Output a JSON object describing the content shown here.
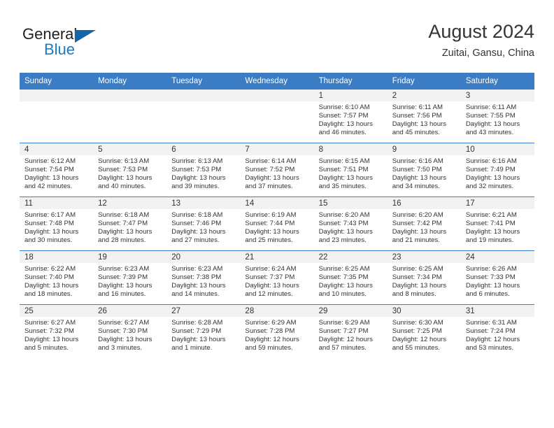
{
  "brand": {
    "name_top": "General",
    "name_bottom": "Blue",
    "accent_color": "#1c7bc0",
    "triangle_color": "#1565a8",
    "triangle_icon": "triangle-icon"
  },
  "header": {
    "month_title": "August 2024",
    "location": "Zuitai, Gansu, China"
  },
  "calendar": {
    "header_bg": "#3b7dc4",
    "daynum_bg": "#f2f2f2",
    "weekdays": [
      "Sunday",
      "Monday",
      "Tuesday",
      "Wednesday",
      "Thursday",
      "Friday",
      "Saturday"
    ],
    "weeks": [
      [
        {
          "day": "",
          "sunrise": "",
          "sunset": "",
          "daylight1": "",
          "daylight2": ""
        },
        {
          "day": "",
          "sunrise": "",
          "sunset": "",
          "daylight1": "",
          "daylight2": ""
        },
        {
          "day": "",
          "sunrise": "",
          "sunset": "",
          "daylight1": "",
          "daylight2": ""
        },
        {
          "day": "",
          "sunrise": "",
          "sunset": "",
          "daylight1": "",
          "daylight2": ""
        },
        {
          "day": "1",
          "sunrise": "Sunrise: 6:10 AM",
          "sunset": "Sunset: 7:57 PM",
          "daylight1": "Daylight: 13 hours",
          "daylight2": "and 46 minutes."
        },
        {
          "day": "2",
          "sunrise": "Sunrise: 6:11 AM",
          "sunset": "Sunset: 7:56 PM",
          "daylight1": "Daylight: 13 hours",
          "daylight2": "and 45 minutes."
        },
        {
          "day": "3",
          "sunrise": "Sunrise: 6:11 AM",
          "sunset": "Sunset: 7:55 PM",
          "daylight1": "Daylight: 13 hours",
          "daylight2": "and 43 minutes."
        }
      ],
      [
        {
          "day": "4",
          "sunrise": "Sunrise: 6:12 AM",
          "sunset": "Sunset: 7:54 PM",
          "daylight1": "Daylight: 13 hours",
          "daylight2": "and 42 minutes."
        },
        {
          "day": "5",
          "sunrise": "Sunrise: 6:13 AM",
          "sunset": "Sunset: 7:53 PM",
          "daylight1": "Daylight: 13 hours",
          "daylight2": "and 40 minutes."
        },
        {
          "day": "6",
          "sunrise": "Sunrise: 6:13 AM",
          "sunset": "Sunset: 7:53 PM",
          "daylight1": "Daylight: 13 hours",
          "daylight2": "and 39 minutes."
        },
        {
          "day": "7",
          "sunrise": "Sunrise: 6:14 AM",
          "sunset": "Sunset: 7:52 PM",
          "daylight1": "Daylight: 13 hours",
          "daylight2": "and 37 minutes."
        },
        {
          "day": "8",
          "sunrise": "Sunrise: 6:15 AM",
          "sunset": "Sunset: 7:51 PM",
          "daylight1": "Daylight: 13 hours",
          "daylight2": "and 35 minutes."
        },
        {
          "day": "9",
          "sunrise": "Sunrise: 6:16 AM",
          "sunset": "Sunset: 7:50 PM",
          "daylight1": "Daylight: 13 hours",
          "daylight2": "and 34 minutes."
        },
        {
          "day": "10",
          "sunrise": "Sunrise: 6:16 AM",
          "sunset": "Sunset: 7:49 PM",
          "daylight1": "Daylight: 13 hours",
          "daylight2": "and 32 minutes."
        }
      ],
      [
        {
          "day": "11",
          "sunrise": "Sunrise: 6:17 AM",
          "sunset": "Sunset: 7:48 PM",
          "daylight1": "Daylight: 13 hours",
          "daylight2": "and 30 minutes."
        },
        {
          "day": "12",
          "sunrise": "Sunrise: 6:18 AM",
          "sunset": "Sunset: 7:47 PM",
          "daylight1": "Daylight: 13 hours",
          "daylight2": "and 28 minutes."
        },
        {
          "day": "13",
          "sunrise": "Sunrise: 6:18 AM",
          "sunset": "Sunset: 7:46 PM",
          "daylight1": "Daylight: 13 hours",
          "daylight2": "and 27 minutes."
        },
        {
          "day": "14",
          "sunrise": "Sunrise: 6:19 AM",
          "sunset": "Sunset: 7:44 PM",
          "daylight1": "Daylight: 13 hours",
          "daylight2": "and 25 minutes."
        },
        {
          "day": "15",
          "sunrise": "Sunrise: 6:20 AM",
          "sunset": "Sunset: 7:43 PM",
          "daylight1": "Daylight: 13 hours",
          "daylight2": "and 23 minutes."
        },
        {
          "day": "16",
          "sunrise": "Sunrise: 6:20 AM",
          "sunset": "Sunset: 7:42 PM",
          "daylight1": "Daylight: 13 hours",
          "daylight2": "and 21 minutes."
        },
        {
          "day": "17",
          "sunrise": "Sunrise: 6:21 AM",
          "sunset": "Sunset: 7:41 PM",
          "daylight1": "Daylight: 13 hours",
          "daylight2": "and 19 minutes."
        }
      ],
      [
        {
          "day": "18",
          "sunrise": "Sunrise: 6:22 AM",
          "sunset": "Sunset: 7:40 PM",
          "daylight1": "Daylight: 13 hours",
          "daylight2": "and 18 minutes."
        },
        {
          "day": "19",
          "sunrise": "Sunrise: 6:23 AM",
          "sunset": "Sunset: 7:39 PM",
          "daylight1": "Daylight: 13 hours",
          "daylight2": "and 16 minutes."
        },
        {
          "day": "20",
          "sunrise": "Sunrise: 6:23 AM",
          "sunset": "Sunset: 7:38 PM",
          "daylight1": "Daylight: 13 hours",
          "daylight2": "and 14 minutes."
        },
        {
          "day": "21",
          "sunrise": "Sunrise: 6:24 AM",
          "sunset": "Sunset: 7:37 PM",
          "daylight1": "Daylight: 13 hours",
          "daylight2": "and 12 minutes."
        },
        {
          "day": "22",
          "sunrise": "Sunrise: 6:25 AM",
          "sunset": "Sunset: 7:35 PM",
          "daylight1": "Daylight: 13 hours",
          "daylight2": "and 10 minutes."
        },
        {
          "day": "23",
          "sunrise": "Sunrise: 6:25 AM",
          "sunset": "Sunset: 7:34 PM",
          "daylight1": "Daylight: 13 hours",
          "daylight2": "and 8 minutes."
        },
        {
          "day": "24",
          "sunrise": "Sunrise: 6:26 AM",
          "sunset": "Sunset: 7:33 PM",
          "daylight1": "Daylight: 13 hours",
          "daylight2": "and 6 minutes."
        }
      ],
      [
        {
          "day": "25",
          "sunrise": "Sunrise: 6:27 AM",
          "sunset": "Sunset: 7:32 PM",
          "daylight1": "Daylight: 13 hours",
          "daylight2": "and 5 minutes."
        },
        {
          "day": "26",
          "sunrise": "Sunrise: 6:27 AM",
          "sunset": "Sunset: 7:30 PM",
          "daylight1": "Daylight: 13 hours",
          "daylight2": "and 3 minutes."
        },
        {
          "day": "27",
          "sunrise": "Sunrise: 6:28 AM",
          "sunset": "Sunset: 7:29 PM",
          "daylight1": "Daylight: 13 hours",
          "daylight2": "and 1 minute."
        },
        {
          "day": "28",
          "sunrise": "Sunrise: 6:29 AM",
          "sunset": "Sunset: 7:28 PM",
          "daylight1": "Daylight: 12 hours",
          "daylight2": "and 59 minutes."
        },
        {
          "day": "29",
          "sunrise": "Sunrise: 6:29 AM",
          "sunset": "Sunset: 7:27 PM",
          "daylight1": "Daylight: 12 hours",
          "daylight2": "and 57 minutes."
        },
        {
          "day": "30",
          "sunrise": "Sunrise: 6:30 AM",
          "sunset": "Sunset: 7:25 PM",
          "daylight1": "Daylight: 12 hours",
          "daylight2": "and 55 minutes."
        },
        {
          "day": "31",
          "sunrise": "Sunrise: 6:31 AM",
          "sunset": "Sunset: 7:24 PM",
          "daylight1": "Daylight: 12 hours",
          "daylight2": "and 53 minutes."
        }
      ]
    ]
  }
}
